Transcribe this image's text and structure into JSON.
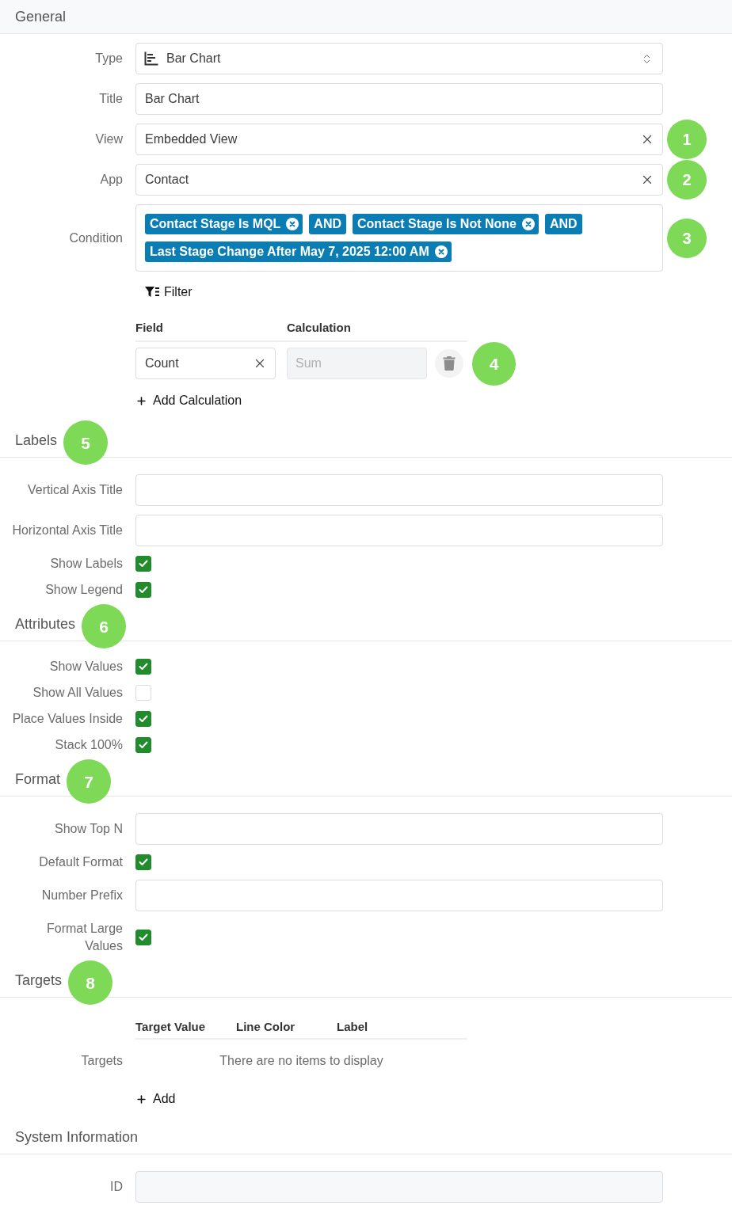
{
  "sections": [
    {
      "title": "General",
      "rows": [
        {
          "kind": "select",
          "label": "Type",
          "value": "Bar Chart"
        },
        {
          "kind": "input",
          "label": "Title",
          "value": "Bar Chart"
        },
        {
          "kind": "clearable",
          "label": "View",
          "value": "Embedded View",
          "marker": "1"
        },
        {
          "kind": "clearable",
          "label": "App",
          "value": "Contact",
          "marker": "2"
        },
        {
          "kind": "condition",
          "label": "Condition",
          "marker": "3",
          "chips": [
            {
              "kind": "filter",
              "text": "Contact Stage Is MQL"
            },
            {
              "kind": "operator",
              "text": "AND"
            },
            {
              "kind": "filter",
              "text": "Contact Stage Is Not None"
            },
            {
              "kind": "operator",
              "text": "AND"
            },
            {
              "kind": "filter",
              "text": "Last Stage Change After May 7, 2025 12:00 AM"
            }
          ]
        },
        {
          "kind": "filter_button",
          "text": "Filter"
        },
        {
          "kind": "calculations",
          "columns": [
            "Field",
            "Calculation"
          ],
          "items": [
            {
              "field": {
                "value": "Count"
              },
              "calculation": {
                "placeholder": "Sum",
                "disabled": true
              },
              "marker": "4"
            }
          ]
        },
        {
          "kind": "add_button",
          "text": "Add Calculation"
        }
      ]
    },
    {
      "title": "Labels",
      "marker": "5",
      "rows": [
        {
          "kind": "input",
          "label": "Vertical Axis Title"
        },
        {
          "kind": "input",
          "label": "Horizontal Axis Title"
        },
        {
          "kind": "checkbox",
          "label": "Show Labels",
          "checked": true
        },
        {
          "kind": "checkbox",
          "label": "Show Legend",
          "checked": true
        }
      ]
    },
    {
      "title": "Attributes",
      "marker": "6",
      "rows": [
        {
          "kind": "checkbox",
          "label": "Show Values",
          "checked": true
        },
        {
          "kind": "checkbox",
          "label": "Show All Values",
          "checked": false
        },
        {
          "kind": "checkbox",
          "label": "Place Values Inside",
          "checked": true
        },
        {
          "kind": "checkbox",
          "label": "Stack 100%",
          "checked": true
        }
      ]
    },
    {
      "title": "Format",
      "marker": "7",
      "rows": [
        {
          "kind": "input",
          "label": "Show Top N"
        },
        {
          "kind": "checkbox",
          "label": "Default Format",
          "checked": true
        },
        {
          "kind": "input",
          "label": "Number Prefix"
        },
        {
          "kind": "checkbox",
          "label": "Format Large Values",
          "checked": true
        }
      ]
    },
    {
      "title": "Targets",
      "marker": "8",
      "rows": [
        {
          "kind": "table",
          "label": "Targets",
          "columns": [
            "Target Value",
            "Line Color",
            "Label"
          ],
          "empty_text": "There are no items to display"
        },
        {
          "kind": "add_button",
          "text": "Add"
        }
      ]
    },
    {
      "title": "System Information",
      "rows": [
        {
          "kind": "readonly_input",
          "label": "ID"
        }
      ]
    }
  ]
}
